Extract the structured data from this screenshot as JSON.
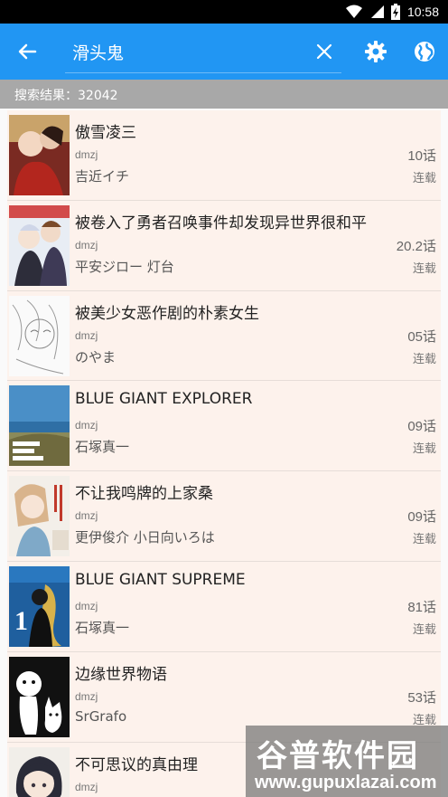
{
  "status_bar": {
    "time": "10:58"
  },
  "app_bar": {
    "back_icon": "arrow-left-icon",
    "search_value": "滑头鬼",
    "clear_icon": "close-icon",
    "settings_icon": "gear-icon",
    "globe_icon": "globe-icon",
    "color": "#2196f3"
  },
  "results": {
    "label": "搜索结果：32042"
  },
  "items": [
    {
      "title": "傲雪凌三",
      "source": "dmzj",
      "author": "吉近イチ",
      "chapter": "10话",
      "status": "连载"
    },
    {
      "title": "被卷入了勇者召唤事件却发现异世界很和平",
      "source": "dmzj",
      "author": "平安ジロー 灯台",
      "chapter": "20.2话",
      "status": "连载"
    },
    {
      "title": "被美少女恶作剧的朴素女生",
      "source": "dmzj",
      "author": "のやま",
      "chapter": "05话",
      "status": "连载"
    },
    {
      "title": "BLUE GIANT EXPLORER",
      "source": "dmzj",
      "author": "石塚真一",
      "chapter": "09话",
      "status": "连载"
    },
    {
      "title": "不让我鸣牌的上家桑",
      "source": "dmzj",
      "author": "更伊俊介 小日向いろは",
      "chapter": "09话",
      "status": "连载"
    },
    {
      "title": "BLUE GIANT SUPREME",
      "source": "dmzj",
      "author": "石塚真一",
      "chapter": "81话",
      "status": "连载"
    },
    {
      "title": "边缘世界物语",
      "source": "dmzj",
      "author": "SrGrafo",
      "chapter": "53话",
      "status": "连载"
    },
    {
      "title": "不可思议的真由理",
      "source": "dmzj",
      "author": "",
      "chapter": "",
      "status": ""
    }
  ],
  "watermark": {
    "title": "谷普软件园",
    "url": "www.gupuxlazai.com"
  }
}
